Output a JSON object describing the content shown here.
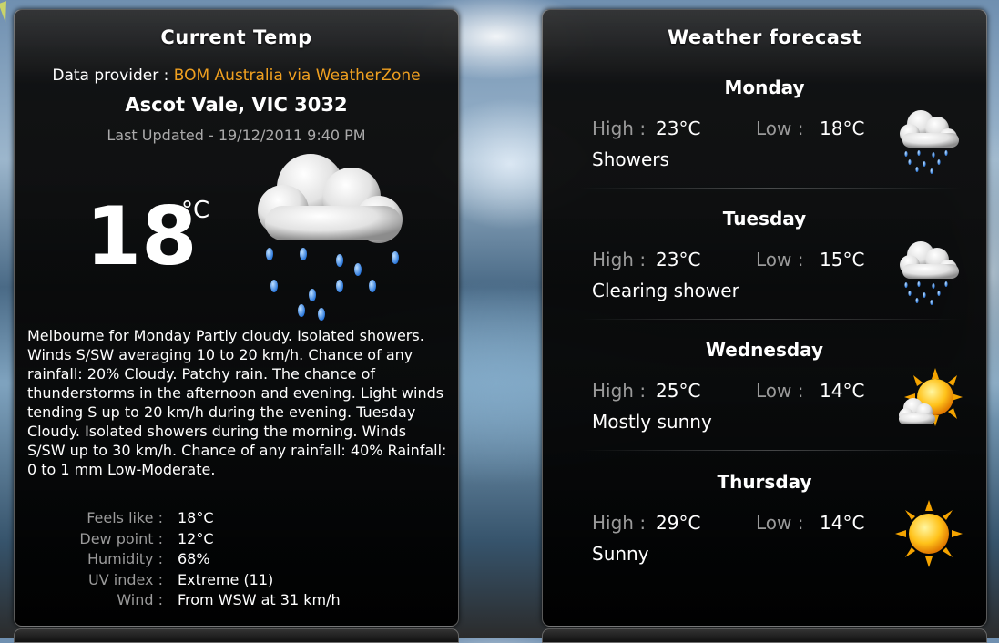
{
  "current": {
    "title": "Current Temp",
    "provider_label": "Data provider : ",
    "provider_link": "BOM Australia via WeatherZone",
    "location": "Ascot Vale, VIC 3032",
    "last_updated": "Last Updated - 19/12/2011 9:40 PM",
    "temperature": "18",
    "unit": "°C",
    "icon": "rain-cloud-icon",
    "description": "Melbourne for Monday Partly cloudy. Isolated showers. Winds S/SW averaging 10 to 20 km/h. Chance of any rainfall: 20% Cloudy. Patchy rain. The chance of thunderstorms in the afternoon and evening. Light winds tending S up to 20 km/h during the evening.    Tuesday Cloudy. Isolated showers during the morning. Winds S/SW up to 30 km/h. Chance of any rainfall: 40% Rainfall: 0 to 1 mm Low-Moderate.",
    "details": [
      {
        "label": "Feels like :",
        "value": "18°C"
      },
      {
        "label": "Dew point :",
        "value": "12°C"
      },
      {
        "label": "Humidity :",
        "value": "68%"
      },
      {
        "label": "UV index :",
        "value": "Extreme (11)"
      },
      {
        "label": "Wind :",
        "value": "From WSW at 31 km/h"
      }
    ]
  },
  "forecast": {
    "title": "Weather forecast",
    "high_label": "High :",
    "low_label": "Low :",
    "days": [
      {
        "name": "Monday",
        "high": "23°C",
        "low": "18°C",
        "condition": "Showers",
        "icon": "showers-icon"
      },
      {
        "name": "Tuesday",
        "high": "23°C",
        "low": "15°C",
        "condition": "Clearing shower",
        "icon": "showers-icon"
      },
      {
        "name": "Wednesday",
        "high": "25°C",
        "low": "14°C",
        "condition": "Mostly sunny",
        "icon": "mostly-sunny-icon"
      },
      {
        "name": "Thursday",
        "high": "29°C",
        "low": "14°C",
        "condition": "Sunny",
        "icon": "sunny-icon"
      }
    ]
  },
  "colors": {
    "accent": "#f0a020",
    "label_gray": "#9a9a9a"
  }
}
